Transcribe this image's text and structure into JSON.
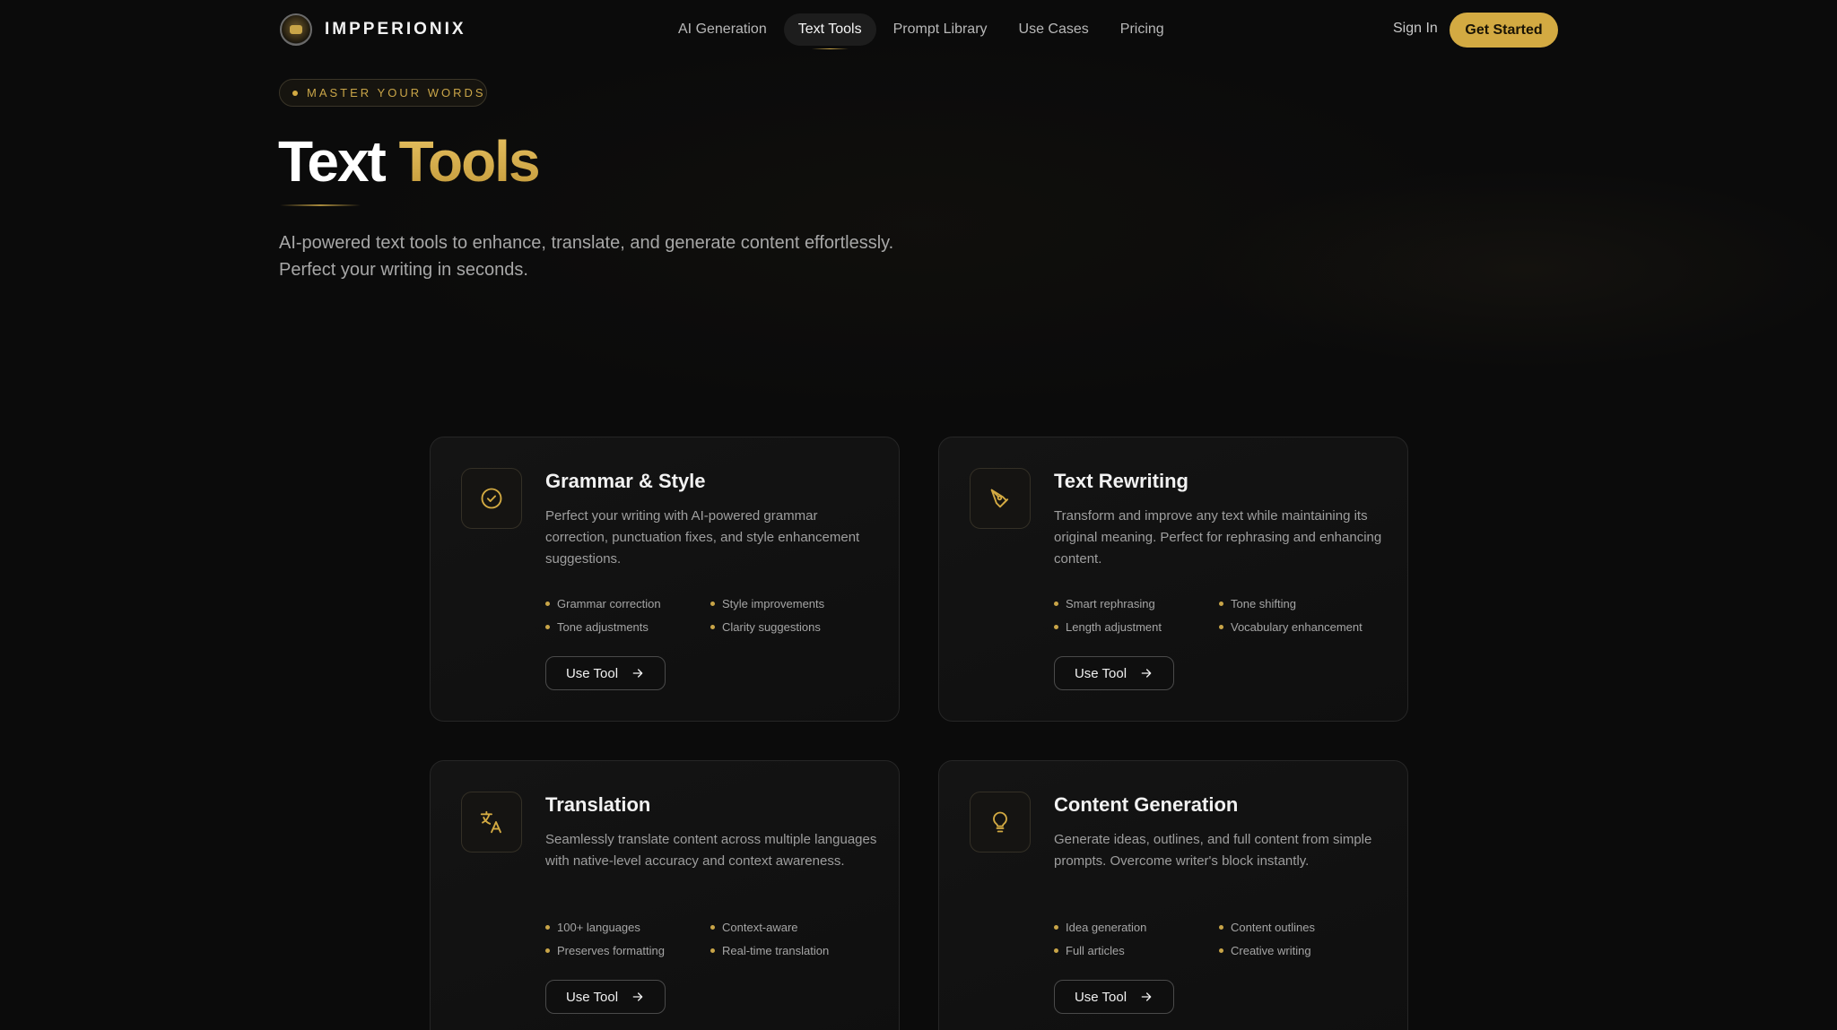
{
  "brand": {
    "name": "IMPPERIONIX"
  },
  "nav": {
    "links": [
      {
        "label": "AI Generation"
      },
      {
        "label": "Text Tools",
        "active": true
      },
      {
        "label": "Prompt Library"
      },
      {
        "label": "Use Cases"
      },
      {
        "label": "Pricing"
      }
    ],
    "sign_in": "Sign In",
    "get_started": "Get Started"
  },
  "hero": {
    "badge": "MASTER YOUR WORDS",
    "title_plain": "Text",
    "title_accent": "Tools",
    "subtitle_line1": "AI-powered text tools to enhance, translate, and generate content effortlessly.",
    "subtitle_line2": "Perfect your writing in seconds."
  },
  "cards": [
    {
      "icon": "check-circle-icon",
      "title": "Grammar & Style",
      "description": "Perfect your writing with AI-powered grammar correction, punctuation fixes, and style enhancement suggestions.",
      "features": [
        "Grammar correction",
        "Style improvements",
        "Tone adjustments",
        "Clarity suggestions"
      ],
      "button": "Use Tool"
    },
    {
      "icon": "pen-tool-icon",
      "title": "Text Rewriting",
      "description": "Transform and improve any text while maintaining its original meaning. Perfect for rephrasing and enhancing content.",
      "features": [
        "Smart rephrasing",
        "Tone shifting",
        "Length adjustment",
        "Vocabulary enhancement"
      ],
      "button": "Use Tool"
    },
    {
      "icon": "translate-icon",
      "title": "Translation",
      "description": "Seamlessly translate content across multiple languages with native-level accuracy and context awareness.",
      "features": [
        "100+ languages",
        "Context-aware",
        "Preserves formatting",
        "Real-time translation"
      ],
      "button": "Use Tool"
    },
    {
      "icon": "lightbulb-icon",
      "title": "Content Generation",
      "description": "Generate ideas, outlines, and full content from simple prompts. Overcome writer's block instantly.",
      "features": [
        "Idea generation",
        "Content outlines",
        "Full articles",
        "Creative writing"
      ],
      "button": "Use Tool"
    }
  ],
  "colors": {
    "accent": "#d3aa42",
    "background": "#0b0b0b",
    "card_border": "#262626"
  }
}
